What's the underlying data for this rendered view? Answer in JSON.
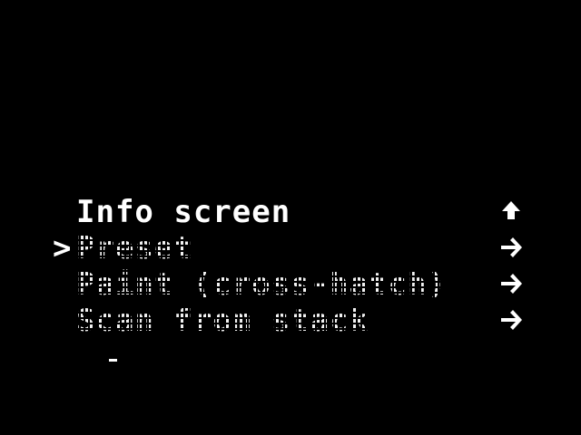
{
  "menu": {
    "cursor_glyph": ">",
    "items": [
      {
        "label": "Info screen",
        "icon": "up-arrow-icon",
        "selected": false
      },
      {
        "label": "Preset",
        "icon": "right-arrow-icon",
        "selected": true
      },
      {
        "label": "Paint (cross-hatch)",
        "icon": "right-arrow-icon",
        "selected": false
      },
      {
        "label": "Scan from stack",
        "icon": "right-arrow-icon",
        "selected": false
      }
    ]
  },
  "colors": {
    "background": "#000000",
    "foreground": "#ffffff"
  }
}
